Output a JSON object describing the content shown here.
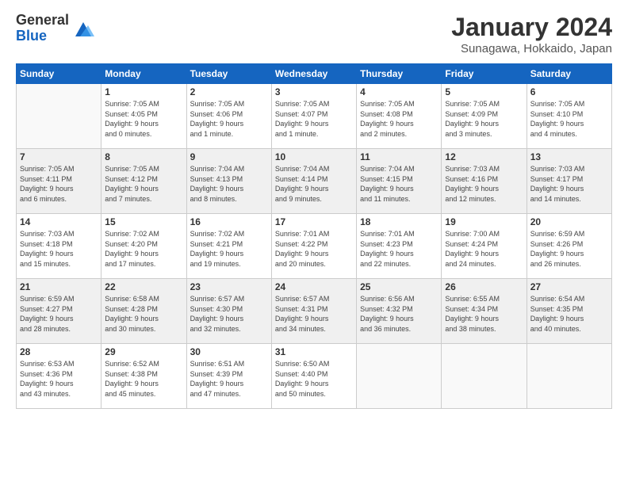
{
  "logo": {
    "general": "General",
    "blue": "Blue"
  },
  "header": {
    "title": "January 2024",
    "subtitle": "Sunagawa, Hokkaido, Japan"
  },
  "weekdays": [
    "Sunday",
    "Monday",
    "Tuesday",
    "Wednesday",
    "Thursday",
    "Friday",
    "Saturday"
  ],
  "weeks": [
    [
      {
        "day": "",
        "info": ""
      },
      {
        "day": "1",
        "info": "Sunrise: 7:05 AM\nSunset: 4:05 PM\nDaylight: 9 hours\nand 0 minutes."
      },
      {
        "day": "2",
        "info": "Sunrise: 7:05 AM\nSunset: 4:06 PM\nDaylight: 9 hours\nand 1 minute."
      },
      {
        "day": "3",
        "info": "Sunrise: 7:05 AM\nSunset: 4:07 PM\nDaylight: 9 hours\nand 1 minute."
      },
      {
        "day": "4",
        "info": "Sunrise: 7:05 AM\nSunset: 4:08 PM\nDaylight: 9 hours\nand 2 minutes."
      },
      {
        "day": "5",
        "info": "Sunrise: 7:05 AM\nSunset: 4:09 PM\nDaylight: 9 hours\nand 3 minutes."
      },
      {
        "day": "6",
        "info": "Sunrise: 7:05 AM\nSunset: 4:10 PM\nDaylight: 9 hours\nand 4 minutes."
      }
    ],
    [
      {
        "day": "7",
        "info": "Sunrise: 7:05 AM\nSunset: 4:11 PM\nDaylight: 9 hours\nand 6 minutes."
      },
      {
        "day": "8",
        "info": "Sunrise: 7:05 AM\nSunset: 4:12 PM\nDaylight: 9 hours\nand 7 minutes."
      },
      {
        "day": "9",
        "info": "Sunrise: 7:04 AM\nSunset: 4:13 PM\nDaylight: 9 hours\nand 8 minutes."
      },
      {
        "day": "10",
        "info": "Sunrise: 7:04 AM\nSunset: 4:14 PM\nDaylight: 9 hours\nand 9 minutes."
      },
      {
        "day": "11",
        "info": "Sunrise: 7:04 AM\nSunset: 4:15 PM\nDaylight: 9 hours\nand 11 minutes."
      },
      {
        "day": "12",
        "info": "Sunrise: 7:03 AM\nSunset: 4:16 PM\nDaylight: 9 hours\nand 12 minutes."
      },
      {
        "day": "13",
        "info": "Sunrise: 7:03 AM\nSunset: 4:17 PM\nDaylight: 9 hours\nand 14 minutes."
      }
    ],
    [
      {
        "day": "14",
        "info": "Sunrise: 7:03 AM\nSunset: 4:18 PM\nDaylight: 9 hours\nand 15 minutes."
      },
      {
        "day": "15",
        "info": "Sunrise: 7:02 AM\nSunset: 4:20 PM\nDaylight: 9 hours\nand 17 minutes."
      },
      {
        "day": "16",
        "info": "Sunrise: 7:02 AM\nSunset: 4:21 PM\nDaylight: 9 hours\nand 19 minutes."
      },
      {
        "day": "17",
        "info": "Sunrise: 7:01 AM\nSunset: 4:22 PM\nDaylight: 9 hours\nand 20 minutes."
      },
      {
        "day": "18",
        "info": "Sunrise: 7:01 AM\nSunset: 4:23 PM\nDaylight: 9 hours\nand 22 minutes."
      },
      {
        "day": "19",
        "info": "Sunrise: 7:00 AM\nSunset: 4:24 PM\nDaylight: 9 hours\nand 24 minutes."
      },
      {
        "day": "20",
        "info": "Sunrise: 6:59 AM\nSunset: 4:26 PM\nDaylight: 9 hours\nand 26 minutes."
      }
    ],
    [
      {
        "day": "21",
        "info": "Sunrise: 6:59 AM\nSunset: 4:27 PM\nDaylight: 9 hours\nand 28 minutes."
      },
      {
        "day": "22",
        "info": "Sunrise: 6:58 AM\nSunset: 4:28 PM\nDaylight: 9 hours\nand 30 minutes."
      },
      {
        "day": "23",
        "info": "Sunrise: 6:57 AM\nSunset: 4:30 PM\nDaylight: 9 hours\nand 32 minutes."
      },
      {
        "day": "24",
        "info": "Sunrise: 6:57 AM\nSunset: 4:31 PM\nDaylight: 9 hours\nand 34 minutes."
      },
      {
        "day": "25",
        "info": "Sunrise: 6:56 AM\nSunset: 4:32 PM\nDaylight: 9 hours\nand 36 minutes."
      },
      {
        "day": "26",
        "info": "Sunrise: 6:55 AM\nSunset: 4:34 PM\nDaylight: 9 hours\nand 38 minutes."
      },
      {
        "day": "27",
        "info": "Sunrise: 6:54 AM\nSunset: 4:35 PM\nDaylight: 9 hours\nand 40 minutes."
      }
    ],
    [
      {
        "day": "28",
        "info": "Sunrise: 6:53 AM\nSunset: 4:36 PM\nDaylight: 9 hours\nand 43 minutes."
      },
      {
        "day": "29",
        "info": "Sunrise: 6:52 AM\nSunset: 4:38 PM\nDaylight: 9 hours\nand 45 minutes."
      },
      {
        "day": "30",
        "info": "Sunrise: 6:51 AM\nSunset: 4:39 PM\nDaylight: 9 hours\nand 47 minutes."
      },
      {
        "day": "31",
        "info": "Sunrise: 6:50 AM\nSunset: 4:40 PM\nDaylight: 9 hours\nand 50 minutes."
      },
      {
        "day": "",
        "info": ""
      },
      {
        "day": "",
        "info": ""
      },
      {
        "day": "",
        "info": ""
      }
    ]
  ]
}
